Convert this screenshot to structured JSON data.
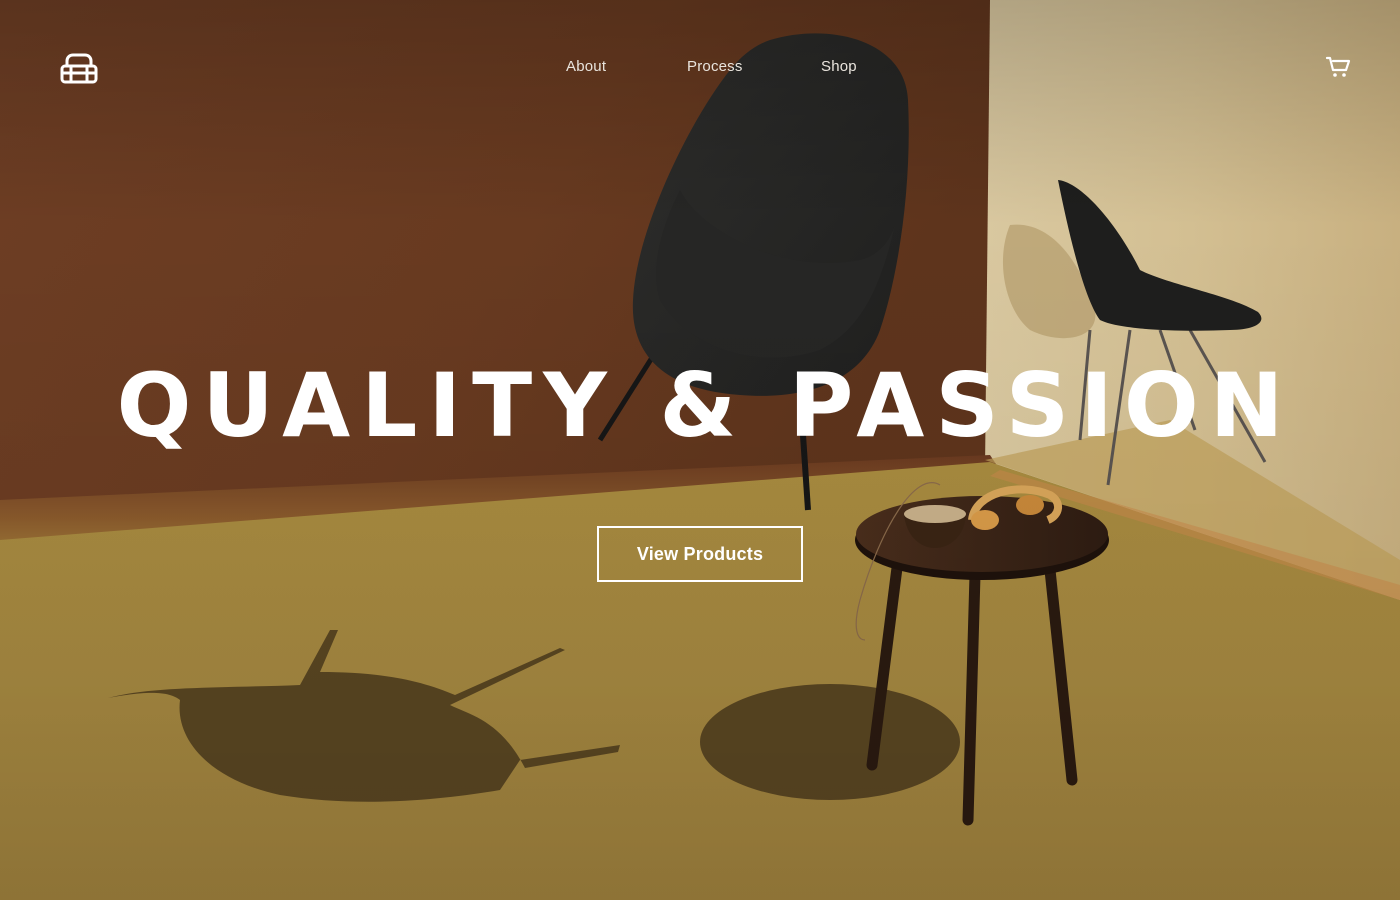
{
  "nav": {
    "logo": "armchair-icon",
    "links": [
      {
        "label": "About"
      },
      {
        "label": "Process"
      },
      {
        "label": "Shop"
      }
    ],
    "cart": "cart-icon"
  },
  "hero": {
    "headline": "QUALITY & PASSION",
    "cta_label": "View Products",
    "background_image": "furniture-studio-photo",
    "colors": {
      "wall_backdrop": "#6a3c22",
      "wall_right": "#d8c49a",
      "floor": "#a3873f",
      "text": "#ffffff"
    }
  }
}
